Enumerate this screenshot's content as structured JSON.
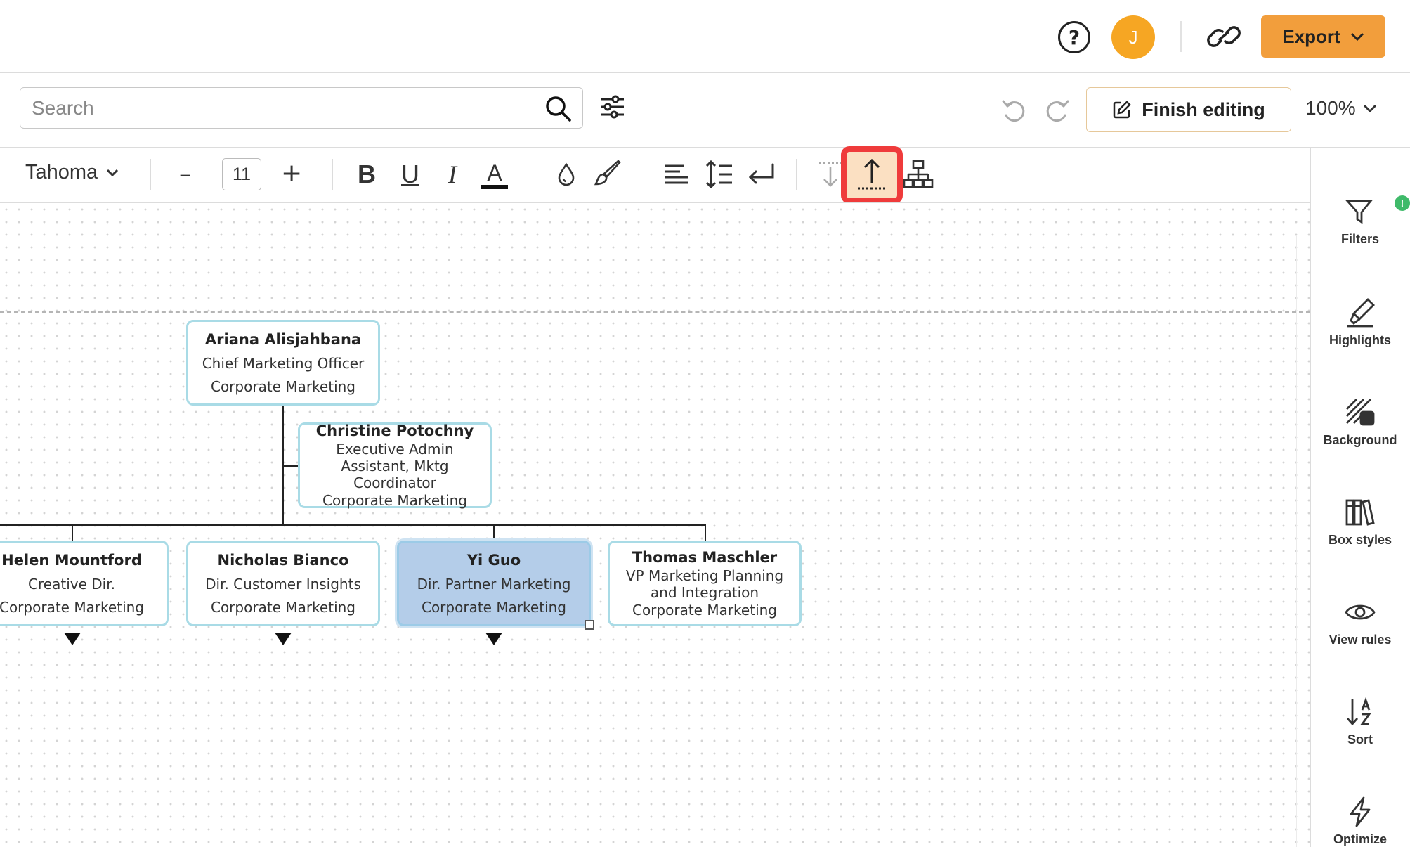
{
  "header": {
    "help_icon": "question-circle-icon",
    "avatar_initial": "J",
    "avatar_color": "#f6a623",
    "link_icon": "link-icon",
    "export_label": "Export",
    "export_color": "#f29e3c"
  },
  "toolbar": {
    "search_placeholder": "Search",
    "finish_editing_label": "Finish editing",
    "zoom_level": "100%"
  },
  "format_bar": {
    "font_family": "Tahoma",
    "font_size": "11",
    "minus_label": "–",
    "plus_label": "+",
    "bold_label": "B",
    "underline_label": "U",
    "italic_label": "I",
    "color_label": "A",
    "highlighted_tool": "move-up-icon",
    "highlight_color": "#ef3b3b"
  },
  "chart": {
    "nodes": [
      {
        "name": "Ariana Alisjahbana",
        "title": "Chief Marketing Officer",
        "dept": "Corporate Marketing"
      },
      {
        "name": "Christine Potochny",
        "title": "Executive Admin Assistant, Mktg Coordinator",
        "dept": "Corporate Marketing"
      },
      {
        "name": "Helen Mountford",
        "title": "Creative Dir.",
        "dept": "Corporate Marketing"
      },
      {
        "name": "Nicholas Bianco",
        "title": "Dir. Customer Insights",
        "dept": "Corporate Marketing"
      },
      {
        "name": "Yi Guo",
        "title": "Dir. Partner Marketing",
        "dept": "Corporate Marketing"
      },
      {
        "name": "Thomas Maschler",
        "title": "VP Marketing Planning and Integration",
        "dept": "Corporate Marketing"
      }
    ],
    "selected_node_color": "#b4cde9",
    "node_border_color": "#a9dbe6"
  },
  "sidebar": {
    "items": [
      {
        "label": "Filters",
        "icon": "filter-icon",
        "badge": "!"
      },
      {
        "label": "Highlights",
        "icon": "highlighter-icon"
      },
      {
        "label": "Background",
        "icon": "background-icon"
      },
      {
        "label": "Box styles",
        "icon": "box-styles-icon"
      },
      {
        "label": "View rules",
        "icon": "eye-icon"
      },
      {
        "label": "Sort",
        "icon": "sort-az-icon"
      },
      {
        "label": "Optimize",
        "icon": "lightning-icon"
      }
    ]
  }
}
